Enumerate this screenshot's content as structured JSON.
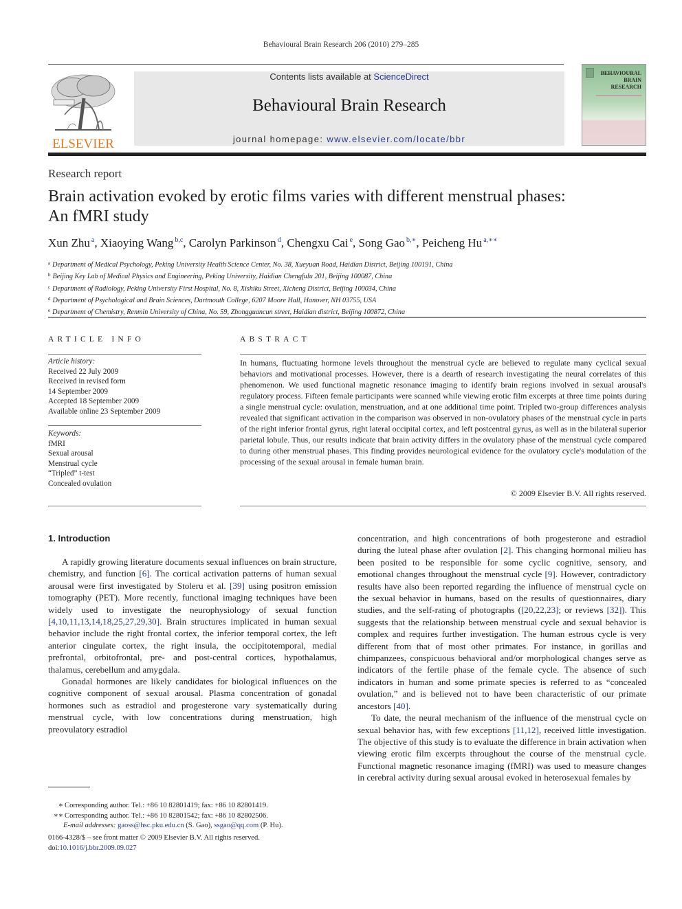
{
  "running_head": "Behavioural Brain Research 206 (2010) 279–285",
  "masthead": {
    "publisher_logo_text": "ELSEVIER",
    "contents_prefix": "Contents lists available at ",
    "contents_link": "ScienceDirect",
    "journal_name": "Behavioural Brain Research",
    "homepage_prefix": "journal homepage: ",
    "homepage_link": "www.elsevier.com/locate/bbr",
    "cover_title_lines": [
      "BEHAVIOURAL",
      "BRAIN",
      "RESEARCH"
    ]
  },
  "article": {
    "section_type": "Research report",
    "title_line1": "Brain activation evoked by erotic films varies with different menstrual phases:",
    "title_line2": "An fMRI study",
    "authors": [
      {
        "name": "Xun Zhu",
        "sup": "a",
        "sep": ", "
      },
      {
        "name": "Xiaoying Wang",
        "sup": "b,c",
        "sep": ", "
      },
      {
        "name": "Carolyn Parkinson",
        "sup": "d",
        "sep": ", "
      },
      {
        "name": "Chengxu Cai",
        "sup": "e",
        "sep": ", "
      },
      {
        "name": "Song Gao",
        "sup": "b,∗",
        "sep": ", "
      },
      {
        "name": "Peicheng Hu",
        "sup": "a,∗∗",
        "sep": ""
      }
    ],
    "affiliations": [
      {
        "key": "a",
        "text": "Department of Medical Psychology, Peking University Health Science Center, No. 38, Xueyuan Road, Haidian District, Beijing 100191, China"
      },
      {
        "key": "b",
        "text": "Beijing Key Lab of Medical Physics and Engineering, Peking University, Haidian Chengfulu 201, Beijing 100087, China"
      },
      {
        "key": "c",
        "text": "Department of Radiology, Peking University First Hospital, No. 8, Xishiku Street, Xicheng District, Beijing 100034, China"
      },
      {
        "key": "d",
        "text": "Department of Psychological and Brain Sciences, Dartmouth College, 6207 Moore Hall, Hanover, NH 03755, USA"
      },
      {
        "key": "e",
        "text": "Department of Chemistry, Renmin University of China, No. 59, Zhongguancun street, Haidian district, Beijing 100872, China"
      }
    ]
  },
  "article_info": {
    "heading": "ARTICLE INFO",
    "history_label": "Article history:",
    "history": [
      "Received 22 July 2009",
      "Received in revised form",
      "14 September 2009",
      "Accepted 18 September 2009",
      "Available online 23 September 2009"
    ],
    "keywords_label": "Keywords:",
    "keywords": [
      "fMRI",
      "Sexual arousal",
      "Menstrual cycle",
      "“Tripled” t-test",
      "Concealed ovulation"
    ]
  },
  "abstract": {
    "heading": "ABSTRACT",
    "text": "In humans, fluctuating hormone levels throughout the menstrual cycle are believed to regulate many cyclical sexual behaviors and motivational processes. However, there is a dearth of research investigating the neural correlates of this phenomenon. We used functional magnetic resonance imaging to identify brain regions involved in sexual arousal's regulatory process. Fifteen female participants were scanned while viewing erotic film excerpts at three time points during a single menstrual cycle: ovulation, menstruation, and at one additional time point. Tripled two-group differences analysis revealed that significant activation in the comparison was observed in non-ovulatory phases of the menstrual cycle in parts of the right inferior frontal gyrus, right lateral occipital cortex, and left postcentral gyrus, as well as in the bilateral superior parietal lobule. Thus, our results indicate that brain activity differs in the ovulatory phase of the menstrual cycle compared to during other menstrual phases. This finding provides neurological evidence for the ovulatory cycle's modulation of the processing of the sexual arousal in female human brain.",
    "copyright": "© 2009 Elsevier B.V. All rights reserved."
  },
  "introduction": {
    "heading": "1.  Introduction",
    "left_paragraphs": [
      [
        {
          "t": "A rapidly growing literature documents sexual influences on brain structure, chemistry, and function "
        },
        {
          "t": "[6]",
          "ref": true
        },
        {
          "t": ". The cortical activation patterns of human sexual arousal were first investigated by Stoleru et al. "
        },
        {
          "t": "[39]",
          "ref": true
        },
        {
          "t": " using positron emission tomography (PET). More recently, functional imaging techniques have been widely used to investigate the neurophysiology of sexual function "
        },
        {
          "t": "[4,10,11,13,14,18,25,27,29,30]",
          "ref": true
        },
        {
          "t": ". Brain structures implicated in human sexual behavior include the right frontal cortex, the inferior temporal cortex, the left anterior cingulate cortex, the right insula, the occipitotemporal, medial prefrontal, orbitofrontal, pre- and post-central cortices, hypothalamus, thalamus, cerebellum and amygdala."
        }
      ],
      [
        {
          "t": "Gonadal hormones are likely candidates for biological influences on the cognitive component of sexual arousal. Plasma concentration of gonadal hormones such as estradiol and progesterone vary systematically during menstrual cycle, with low concentrations during menstruation, high preovulatory estradiol"
        }
      ]
    ],
    "right_paragraphs": [
      [
        {
          "t": "concentration, and high concentrations of both progesterone and estradiol during the luteal phase after ovulation "
        },
        {
          "t": "[2]",
          "ref": true
        },
        {
          "t": ". This changing hormonal milieu has been posited to be responsible for some cyclic cognitive, sensory, and emotional changes throughout the menstrual cycle "
        },
        {
          "t": "[9]",
          "ref": true
        },
        {
          "t": ". However, contradictory results have also been reported regarding the influence of menstrual cycle on the sexual behavior in humans, based on the results of questionnaires, diary studies, and the self-rating of photographs ("
        },
        {
          "t": "[20,22,23]",
          "ref": true
        },
        {
          "t": "; or reviews "
        },
        {
          "t": "[32]",
          "ref": true
        },
        {
          "t": "). This suggests that the relationship between menstrual cycle and sexual behavior is complex and requires further investigation. The human estrous cycle is very different from that of most other primates. For instance, in gorillas and chimpanzees, conspicuous behavioral and/or morphological changes serve as indicators of the fertile phase of the female cycle. The absence of such indicators in human and some primate species is referred to as “concealed ovulation,” and is believed not to have been characteristic of our primate ancestors "
        },
        {
          "t": "[40]",
          "ref": true
        },
        {
          "t": "."
        }
      ],
      [
        {
          "t": "To date, the neural mechanism of the influence of the menstrual cycle on sexual behavior has, with few exceptions "
        },
        {
          "t": "[11,12]",
          "ref": true
        },
        {
          "t": ", received little investigation. The objective of this study is to evaluate the difference in brain activation when viewing erotic film excerpts throughout the course of the menstrual cycle. Functional magnetic resonance imaging (fMRI) was used to measure changes in cerebral activity during sexual arousal evoked in heterosexual females by"
        }
      ]
    ]
  },
  "footnotes": {
    "fn1_mark": "∗",
    "fn1_text": "Corresponding author. Tel.: +86 10 82801419; fax: +86 10 82801419.",
    "fn2_mark": "∗∗",
    "fn2_text": "Corresponding author. Tel.: +86 10 82801542; fax: +86 10 82802506.",
    "email_label": "E-mail addresses:",
    "email1": "gaoss@hsc.pku.edu.cn",
    "email1_owner": " (S. Gao), ",
    "email2": "ssgao@qq.com",
    "email2_owner": " (P. Hu)."
  },
  "footer": {
    "issn_line": "0166-4328/$ – see front matter © 2009 Elsevier B.V. All rights reserved.",
    "doi_prefix": "doi:",
    "doi_link": "10.1016/j.bbr.2009.09.027"
  },
  "colors": {
    "link": "#2a3a8c",
    "elsevier_orange": "#e07b20",
    "banner_gray": "#e8e8e8"
  }
}
